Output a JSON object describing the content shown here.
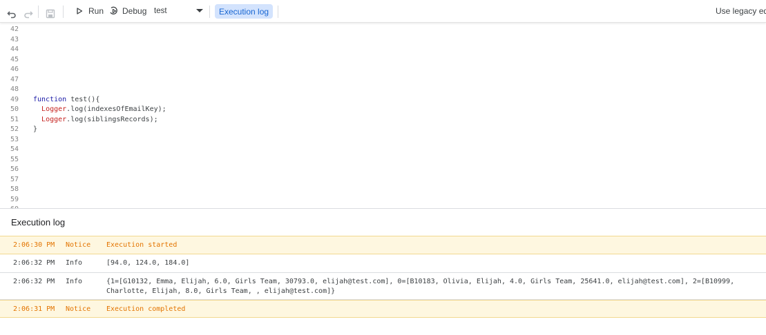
{
  "toolbar": {
    "run_label": "Run",
    "debug_label": "Debug",
    "function_select": "test",
    "execution_log_label": "Execution log",
    "legacy_label": "Use legacy ed"
  },
  "editor": {
    "lines": [
      {
        "num": "42",
        "text": ""
      },
      {
        "num": "43",
        "text": ""
      },
      {
        "num": "44",
        "text": ""
      },
      {
        "num": "45",
        "text": ""
      },
      {
        "num": "46",
        "text": ""
      },
      {
        "num": "47",
        "text": ""
      },
      {
        "num": "48",
        "text": ""
      },
      {
        "num": "49",
        "text": "function test(){"
      },
      {
        "num": "50",
        "text": "  Logger.log(indexesOfEmailKey);"
      },
      {
        "num": "51",
        "text": "  Logger.log(siblingsRecords);"
      },
      {
        "num": "52",
        "text": "}"
      },
      {
        "num": "53",
        "text": ""
      },
      {
        "num": "54",
        "text": ""
      },
      {
        "num": "55",
        "text": ""
      },
      {
        "num": "56",
        "text": ""
      },
      {
        "num": "57",
        "text": ""
      },
      {
        "num": "58",
        "text": ""
      },
      {
        "num": "59",
        "text": ""
      },
      {
        "num": "60",
        "text": ""
      }
    ]
  },
  "log": {
    "title": "Execution log",
    "rows": [
      {
        "time": "2:06:30 PM",
        "level": "Notice",
        "message": "Execution started"
      },
      {
        "time": "2:06:32 PM",
        "level": "Info",
        "message": "[94.0, 124.0, 184.0]"
      },
      {
        "time": "2:06:32 PM",
        "level": "Info",
        "message": "{1=[G10132, Emma, Elijah, 6.0, Girls Team, 30793.0, elijah@test.com], 0=[B10183, Olivia, Elijah, 4.0, Girls Team, 25641.0, elijah@test.com], 2=[B10999, Charlotte, Elijah, 8.0, Girls Team, , elijah@test.com]}"
      },
      {
        "time": "2:06:31 PM",
        "level": "Notice",
        "message": "Execution completed"
      }
    ]
  },
  "colors": {
    "accent": "#1967d2",
    "accent_bg": "#d3e3fd",
    "notice_bg": "#fef7e0",
    "notice_text": "#e37400"
  }
}
